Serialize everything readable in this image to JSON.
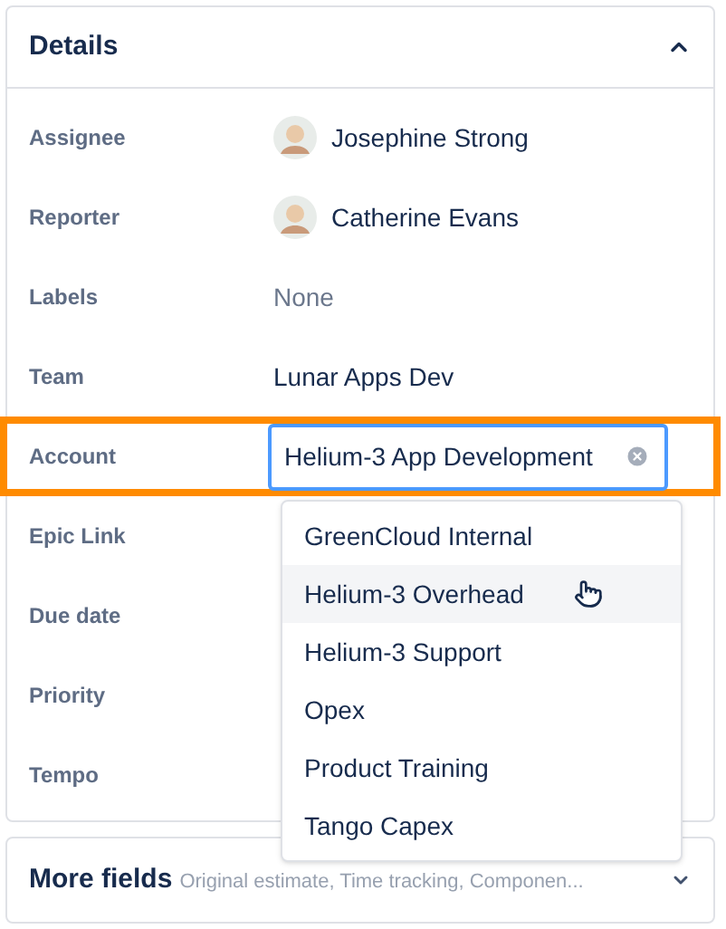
{
  "details": {
    "title": "Details",
    "expanded": true,
    "fields": [
      {
        "label": "Assignee",
        "kind": "user",
        "value": "Josephine Strong"
      },
      {
        "label": "Reporter",
        "kind": "user",
        "value": "Catherine Evans"
      },
      {
        "label": "Labels",
        "kind": "empty",
        "value": "None"
      },
      {
        "label": "Team",
        "kind": "text",
        "value": "Lunar Apps Dev"
      },
      {
        "label": "Account",
        "kind": "select",
        "value": "Helium-3 App Development",
        "highlighted": true
      },
      {
        "label": "Epic Link",
        "kind": "blank"
      },
      {
        "label": "Due date",
        "kind": "blank"
      },
      {
        "label": "Priority",
        "kind": "blank"
      },
      {
        "label": "Tempo",
        "kind": "blank"
      }
    ]
  },
  "dropdown": {
    "options": [
      {
        "label": "GreenCloud Internal",
        "selected": false
      },
      {
        "label": "Helium-3 Overhead",
        "selected": true
      },
      {
        "label": "Helium-3 Support",
        "selected": false
      },
      {
        "label": "Opex",
        "selected": false
      },
      {
        "label": "Product Training",
        "selected": false
      },
      {
        "label": "Tango Capex",
        "selected": false
      }
    ]
  },
  "more_fields": {
    "title": "More fields",
    "summary": "Original estimate, Time tracking, Componen...",
    "expanded": false
  }
}
